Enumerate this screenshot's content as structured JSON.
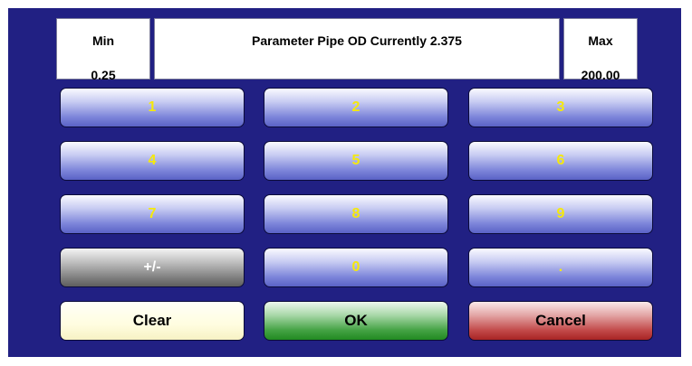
{
  "header": {
    "min_label": "Min",
    "min_value": "0.25",
    "title": "Parameter Pipe OD Currently 2.375",
    "max_label": "Max",
    "max_value": "200.00"
  },
  "keypad": {
    "k1": "1",
    "k2": "2",
    "k3": "3",
    "k4": "4",
    "k5": "5",
    "k6": "6",
    "k7": "7",
    "k8": "8",
    "k9": "9",
    "plus_minus": "+/-",
    "k0": "0",
    "decimal": "."
  },
  "actions": {
    "clear": "Clear",
    "ok": "OK",
    "cancel": "Cancel"
  },
  "colors": {
    "background": "#212083",
    "digit_text": "#f5e90c",
    "ok_button": "#44a244",
    "cancel_button": "#c24a4a",
    "clear_button": "#fffde0"
  }
}
